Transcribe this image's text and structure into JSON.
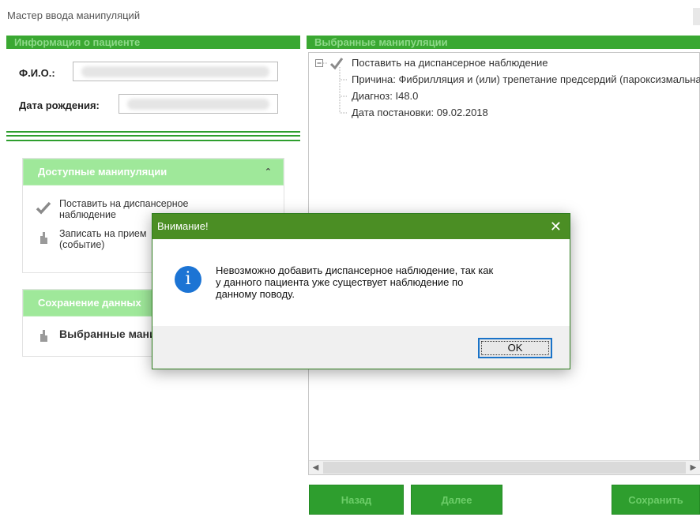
{
  "window": {
    "title": "Мастер ввода манипуляций"
  },
  "patient_panel": {
    "header": "Информация о пациенте",
    "fio_label": "Ф.И.О.:",
    "dob_label": "Дата рождения:"
  },
  "available": {
    "header": "Доступные манипуляции",
    "items": [
      "Поставить на диспансерное наблюдение",
      "Записать на прием (событие)"
    ]
  },
  "save_section": {
    "header": "Сохранение данных",
    "item": "Выбранные манипуляции"
  },
  "selected": {
    "header": "Выбранные манипуляции",
    "root": "Поставить на диспансерное наблюдение",
    "children": [
      "Причина: Фибрилляция и (или) трепетание предсердий (пароксизмальная)",
      "Диагноз: I48.0",
      "Дата постановки: 09.02.2018"
    ]
  },
  "buttons": {
    "back": "Назад",
    "next": "Далее",
    "save": "Сохранить"
  },
  "dialog": {
    "title": "Внимание!",
    "message_lines": [
      "Невозможно добавить диспансерное наблюдение, так как",
      "у данного пациента уже существует наблюдение по",
      "данному поводу."
    ],
    "ok": "OK"
  }
}
